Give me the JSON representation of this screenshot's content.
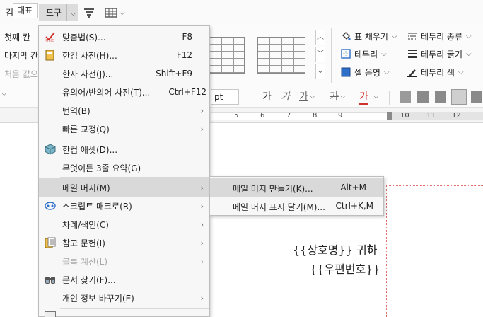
{
  "menubar": {
    "review_label": "검토",
    "tools_label": "도구"
  },
  "ribbon_left": {
    "first_cell": "첫째 칸",
    "last_cell": "마지막 칸",
    "initial_value": "처음 값으"
  },
  "ribbon_right": {
    "fill_label": "표 채우기",
    "border_label": "테두리",
    "cell_shade_label": "셀 음영",
    "border_type_label": "테두리 종류",
    "border_weight_label": "테두리 굵기",
    "border_color_label": "테두리 색"
  },
  "formatbar": {
    "style_value": "대표",
    "size_unit": "pt",
    "glyph_ga": "가"
  },
  "ruler": {
    "numbers": [
      "5",
      "6",
      "7",
      "8",
      "9",
      "10",
      "11",
      "12"
    ]
  },
  "dropdown": {
    "items": [
      {
        "label": "맞춤법(S)...",
        "shortcut": "F8",
        "icon": "spellcheck-icon"
      },
      {
        "label": "한컴 사전(H)...",
        "shortcut": "F12",
        "icon": "dictionary-icon"
      },
      {
        "label": "한자 사전(J)...",
        "shortcut": "Shift+F9"
      },
      {
        "label": "유의어/반의어 사전(T)...",
        "shortcut": "Ctrl+F12"
      },
      {
        "label": "번역(B)",
        "arrow": "›"
      },
      {
        "label": "빠른 교정(Q)",
        "arrow": "›"
      },
      {
        "label": "한컴 애셋(D)...",
        "icon": "asset-cube-icon"
      },
      {
        "label": "무엇이든 3줄 요약(G)"
      },
      {
        "label": "메일 머지(M)",
        "arrow": "›"
      },
      {
        "label": "스크립트 매크로(R)",
        "arrow": "›",
        "icon": "macro-icon"
      },
      {
        "label": "차례/색인(C)",
        "arrow": "›"
      },
      {
        "label": "참고 문헌(I)",
        "arrow": "›",
        "icon": "reference-icon"
      },
      {
        "label": "블록 계산(L)",
        "arrow": "›"
      },
      {
        "label": "문서 찾기(F)...",
        "icon": "binoculars-icon"
      },
      {
        "label": "개인 정보 바꾸기(E)",
        "arrow": "›"
      }
    ]
  },
  "submenu": {
    "items": [
      {
        "label": "메일 머지 만들기(K)...",
        "shortcut": "Alt+M"
      },
      {
        "label": "메일 머지 표시 달기(M)...",
        "shortcut": "Ctrl+K,M"
      }
    ]
  },
  "document": {
    "line1": "{{상호명}} 귀하",
    "line2": "{{우편번호}}"
  },
  "colors": {
    "accent_red": "#d0312d",
    "accent_blue": "#2e6fc9",
    "highlight": "#d9d9d9"
  }
}
